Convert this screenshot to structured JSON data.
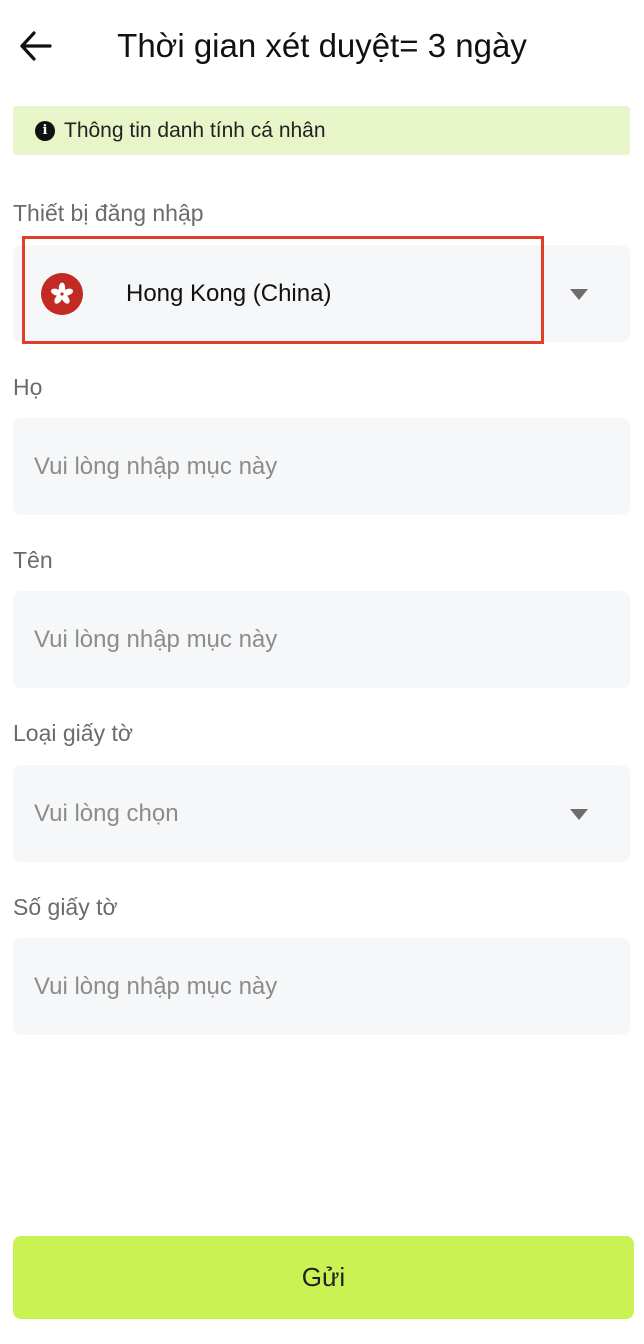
{
  "header": {
    "title": "Thời gian xét duyệt= 3 ngày",
    "back_icon": "arrow-left-icon"
  },
  "notice": {
    "icon": "info-icon",
    "icon_glyph": "i",
    "text": "Thông tin danh tính cá nhân",
    "background": "#e8f5c8"
  },
  "form": {
    "country": {
      "label": "Thiết bị đăng nhập",
      "value": "Hong Kong (China)",
      "flag_icon": "hong-kong-flag-icon"
    },
    "last_name": {
      "label": "Họ",
      "placeholder": "Vui lòng nhập mục này"
    },
    "first_name": {
      "label": "Tên",
      "placeholder": "Vui lòng nhập mục này"
    },
    "document_type": {
      "label": "Loại giấy tờ",
      "placeholder": "Vui lòng chọn"
    },
    "document_number": {
      "label": "Số giấy tờ",
      "placeholder": "Vui lòng nhập mục này"
    }
  },
  "submit": {
    "label": "Gửi",
    "color": "#cbf253"
  },
  "colors": {
    "highlight_border": "#e0402a",
    "field_background": "#f6f7f9",
    "flag": "#c22b24"
  }
}
